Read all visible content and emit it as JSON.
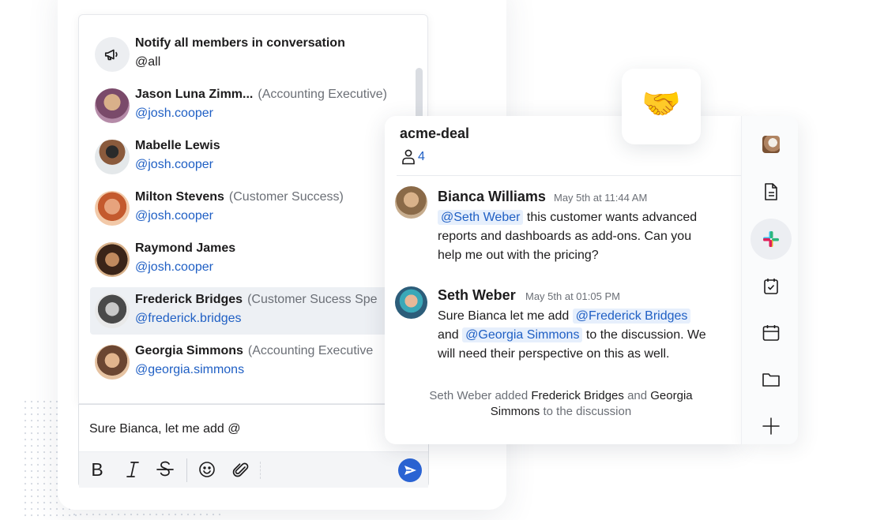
{
  "mention_list": {
    "items": [
      {
        "name": "Notify all members in conversation",
        "role": "",
        "handle": "@all",
        "avatar": "megaphone-icon"
      },
      {
        "name": "Jason Luna Zimm...",
        "role": "(Accounting Executive)",
        "handle": "@josh.cooper"
      },
      {
        "name": "Mabelle Lewis",
        "role": "",
        "handle": "@josh.cooper"
      },
      {
        "name": "Milton Stevens",
        "role": "(Customer Success)",
        "handle": "@josh.cooper"
      },
      {
        "name": "Raymond James",
        "role": "",
        "handle": "@josh.cooper"
      },
      {
        "name": "Frederick Bridges",
        "role": "(Customer Sucess Spe",
        "handle": "@frederick.bridges"
      },
      {
        "name": "Georgia Simmons",
        "role": "(Accounting Executive",
        "handle": "@georgia.simmons"
      }
    ],
    "selected_index": 5
  },
  "composer": {
    "text": "Sure Bianca, let me add @",
    "toolbar": [
      "bold-icon",
      "italic-icon",
      "strikethrough-icon",
      "emoji-icon",
      "attachment-icon",
      "send-icon"
    ]
  },
  "channel": {
    "emoji": "🤝",
    "title": "acme-deal",
    "member_count": "4",
    "messages": [
      {
        "author": "Bianca Williams",
        "time": "May 5th at 11:44 AM",
        "mention": "@Seth Weber",
        "line1": "this customer wants advanced",
        "line2": "reports and dashboards as add-ons. Can you",
        "line3": "help me out with the pricing?"
      },
      {
        "author": "Seth Weber",
        "time": "May 5th at 01:05 PM",
        "line1": "Sure Bianca let me add",
        "mention1": "@Frederick Bridges",
        "and": "and",
        "mention2": "@Georgia Simmons",
        "line2_tail": "to the discussion. We",
        "line3": "will need their perspective on this as well."
      }
    ],
    "system": {
      "actor": "Seth Weber added",
      "user1": "Frederick Bridges",
      "and": "and",
      "user2a": "Georgia",
      "user2b": "Simmons",
      "tail": "to the discussion"
    }
  },
  "rail": [
    "dog-avatar-icon",
    "document-icon",
    "slack-icon",
    "checklist-icon",
    "calendar-icon",
    "folder-icon",
    "plus-icon"
  ],
  "colors": {
    "accent": "#2a63d3",
    "mention_bg": "#e6effc",
    "mention_text": "#1f5fc4"
  }
}
